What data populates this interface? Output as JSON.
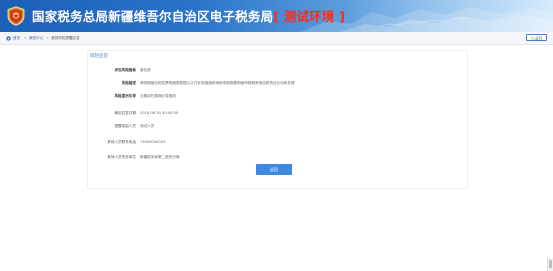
{
  "header": {
    "title": "国家税务总局新疆维吾尔自治区电子税务局",
    "env_label": "[ 测试环境 ]"
  },
  "breadcrumb": {
    "items": [
      "首页",
      "我的中心",
      "我的风险提醒应答"
    ],
    "separator": ">"
  },
  "toolbar": {
    "back_label": "返回",
    "back_icon": "return-arrow-icon"
  },
  "section": {
    "title": "风险应答"
  },
  "fields": [
    {
      "label": "涉及风险指标",
      "value": "营业税"
    },
    {
      "label": "风险描述",
      "value": "请同期营业税发票明细表数据以计并补报增值税纳税申报数据明细申报期其他应税项目比对和处理"
    },
    {
      "label": "风险提示引导",
      "value": "当期或归属期计算规则"
    },
    {
      "label": "最迟应答日期",
      "value": "2019-06-30 00:00:00"
    },
    {
      "label": "提醒发起人员",
      "value": "测试人员"
    },
    {
      "label": "其他人员联系电话",
      "value": "13900000003"
    },
    {
      "label": "其他人员所在单位",
      "value": "新疆税务局第二税务分局"
    }
  ],
  "actions": {
    "return_label": "返回"
  },
  "colors": {
    "header_blue": "#1d5fb8",
    "env_red": "#ff2a1a",
    "accent": "#3f88e0"
  }
}
